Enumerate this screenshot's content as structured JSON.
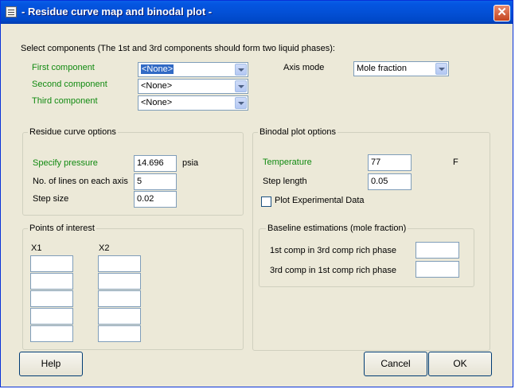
{
  "window": {
    "title": "- Residue curve map and binodal plot -",
    "close_glyph": "✕"
  },
  "select_components": {
    "instruction": "Select components (The 1st and 3rd components should form two liquid phases):",
    "first_label": "First component",
    "first_value": "<None>",
    "second_label": "Second component",
    "second_value": "<None>",
    "third_label": "Third component",
    "third_value": "<None>",
    "axis_mode_label": "Axis mode",
    "axis_mode_value": "Mole fraction"
  },
  "residue_curve": {
    "legend": "Residue curve options",
    "pressure_label": "Specify pressure",
    "pressure_value": "14.696",
    "pressure_unit": "psia",
    "lines_label": "No. of lines on each axis",
    "lines_value": "5",
    "step_size_label": "Step size",
    "step_size_value": "0.02"
  },
  "points_of_interest": {
    "legend": "Points of interest",
    "x1_label": "X1",
    "x2_label": "X2"
  },
  "binodal": {
    "legend": "Binodal plot options",
    "temperature_label": "Temperature",
    "temperature_value": "77",
    "temperature_unit": "F",
    "step_length_label": "Step length",
    "step_length_value": "0.05",
    "plot_experimental_label": "Plot Experimental Data",
    "plot_experimental_checked": false
  },
  "baseline": {
    "legend": "Baseline estimations (mole fraction)",
    "first_label": "1st comp in 3rd comp rich phase",
    "first_value": "",
    "third_label": "3rd comp in 1st comp rich phase",
    "third_value": ""
  },
  "buttons": {
    "help": "Help",
    "cancel": "Cancel",
    "ok": "OK"
  },
  "colors": {
    "title_bar": "#0350d6",
    "dialog_bg": "#ece9d8",
    "green_label": "#118a11",
    "selection": "#316ac5",
    "close_button": "#c4451f"
  }
}
